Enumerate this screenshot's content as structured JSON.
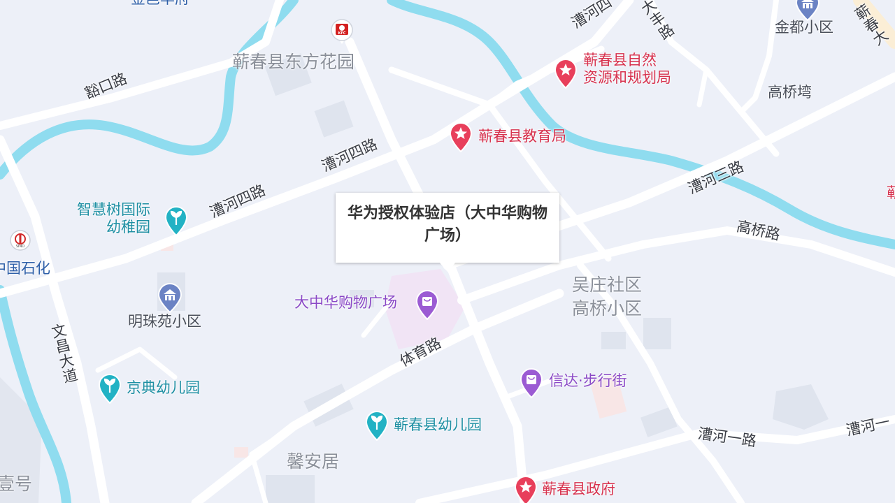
{
  "map": {
    "popup": {
      "text": "华为授权体验店（大中华购物广场）"
    },
    "roads": [
      {
        "id": "laokou",
        "label": "豁口路"
      },
      {
        "id": "caohe4a",
        "label": "漕河四路"
      },
      {
        "id": "caohe4b",
        "label": "漕河四路"
      },
      {
        "id": "caohe4c",
        "label": "漕河四"
      },
      {
        "id": "caohe3",
        "label": "漕河三路"
      },
      {
        "id": "gaoqiao",
        "label": "高桥路"
      },
      {
        "id": "tiyu",
        "label": "体育路"
      },
      {
        "id": "wenchang",
        "label": "文昌大道"
      },
      {
        "id": "caohe1",
        "label": "漕河一路"
      },
      {
        "id": "caohe1b",
        "label": "漕河一"
      },
      {
        "id": "dafeng",
        "label": "大丰路"
      },
      {
        "id": "qichun_edge",
        "label": "蕲春大"
      }
    ],
    "areas": [
      {
        "id": "dongfang",
        "label": "蕲春县东方花园"
      },
      {
        "id": "wuzhuang1",
        "label": "吴庄社区"
      },
      {
        "id": "wuzhuang2",
        "label": "高桥小区"
      },
      {
        "id": "xinan",
        "label": "馨安居"
      },
      {
        "id": "yihao",
        "label": "壹号"
      }
    ],
    "pois": [
      {
        "id": "ziran",
        "line1": "蕲春县自然",
        "line2": "资源和规划局",
        "icon": "star-pin-icon"
      },
      {
        "id": "jiaoyu",
        "label": "蕲春县教育局",
        "icon": "star-pin-icon"
      },
      {
        "id": "zhengfu",
        "label": "蕲春县政府",
        "icon": "star-pin-icon"
      },
      {
        "id": "zhihuishu",
        "line1": "智慧树国际",
        "line2": "幼稚园",
        "icon": "sprout-pin-icon"
      },
      {
        "id": "jingdian",
        "label": "京典幼儿园",
        "icon": "sprout-pin-icon"
      },
      {
        "id": "youeryuan",
        "label": "蕲春县幼儿园",
        "icon": "sprout-pin-icon"
      },
      {
        "id": "dazhonghua",
        "label": "大中华购物广场",
        "icon": "shopping-bag-icon"
      },
      {
        "id": "xinda",
        "label": "信达·步行街",
        "icon": "shopping-bag-icon"
      },
      {
        "id": "mingzhu",
        "label": "明珠苑小区",
        "icon": "residence-icon"
      },
      {
        "id": "jindu",
        "label": "金都小区",
        "icon": "residence-icon"
      },
      {
        "id": "gaoqiaowan",
        "label": "高桥塆"
      },
      {
        "id": "sinopec",
        "label": "中国石化",
        "icon": "sinopec-icon"
      },
      {
        "id": "kfc",
        "icon": "kfc-icon"
      },
      {
        "id": "jinyi",
        "label": "金邑华府"
      }
    ],
    "colors": {
      "background": "#edf0f8",
      "road": "#ffffff",
      "river": "#8fdcef",
      "block": "#dfe4ee",
      "red_poi": "#d7334f",
      "teal_poi": "#1e8fa3",
      "purple_poi": "#8a49c6"
    }
  }
}
